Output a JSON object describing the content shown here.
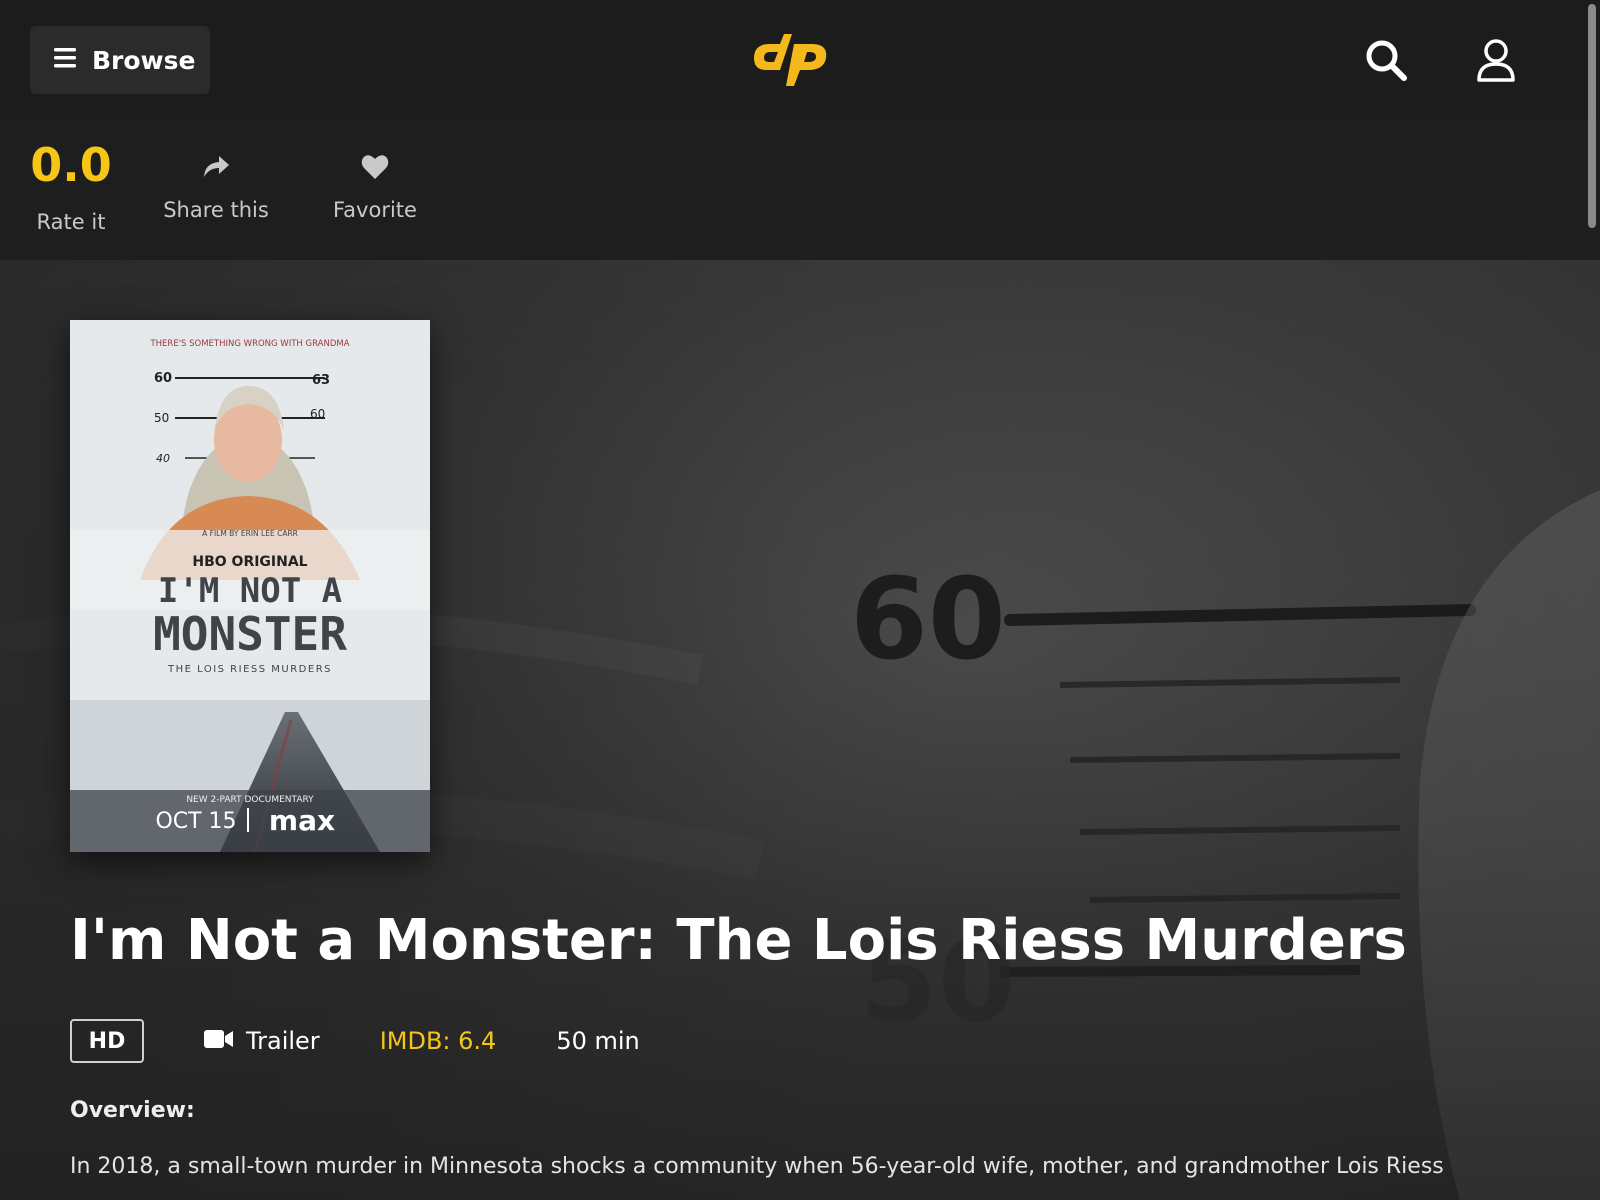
{
  "header": {
    "browse_label": "Browse",
    "logo_text": "dp",
    "brand_color": "#f5c518"
  },
  "actions": {
    "rating_value": "0.0",
    "rate_label": "Rate it",
    "share_label": "Share this",
    "favorite_label": "Favorite"
  },
  "movie": {
    "title": "I'm Not a Monster: The Lois Riess Murders",
    "quality": "HD",
    "trailer_label": "Trailer",
    "imdb": "IMDB: 6.4",
    "runtime": "50 min",
    "overview_heading": "Overview:",
    "overview": "In 2018, a small-town murder in Minnesota shocks a community when 56-year-old wife, mother, and grandmother Lois Riess"
  },
  "poster": {
    "tagline": "THERE'S SOMETHING WRONG WITH GRANDMA",
    "credit": "A FILM BY ERIN LEE CARR",
    "network": "HBO ORIGINAL",
    "title_line1": "I'M NOT A",
    "title_line2": "MONSTER",
    "subtitle": "THE LOIS RIESS MURDERS",
    "format": "NEW 2-PART DOCUMENTARY",
    "date": "OCT 15",
    "platform": "max",
    "scale_left": [
      "60",
      "50",
      "40"
    ],
    "scale_right": [
      "63",
      "60"
    ]
  },
  "backdrop": {
    "scale_marks": [
      "60",
      "50"
    ]
  }
}
